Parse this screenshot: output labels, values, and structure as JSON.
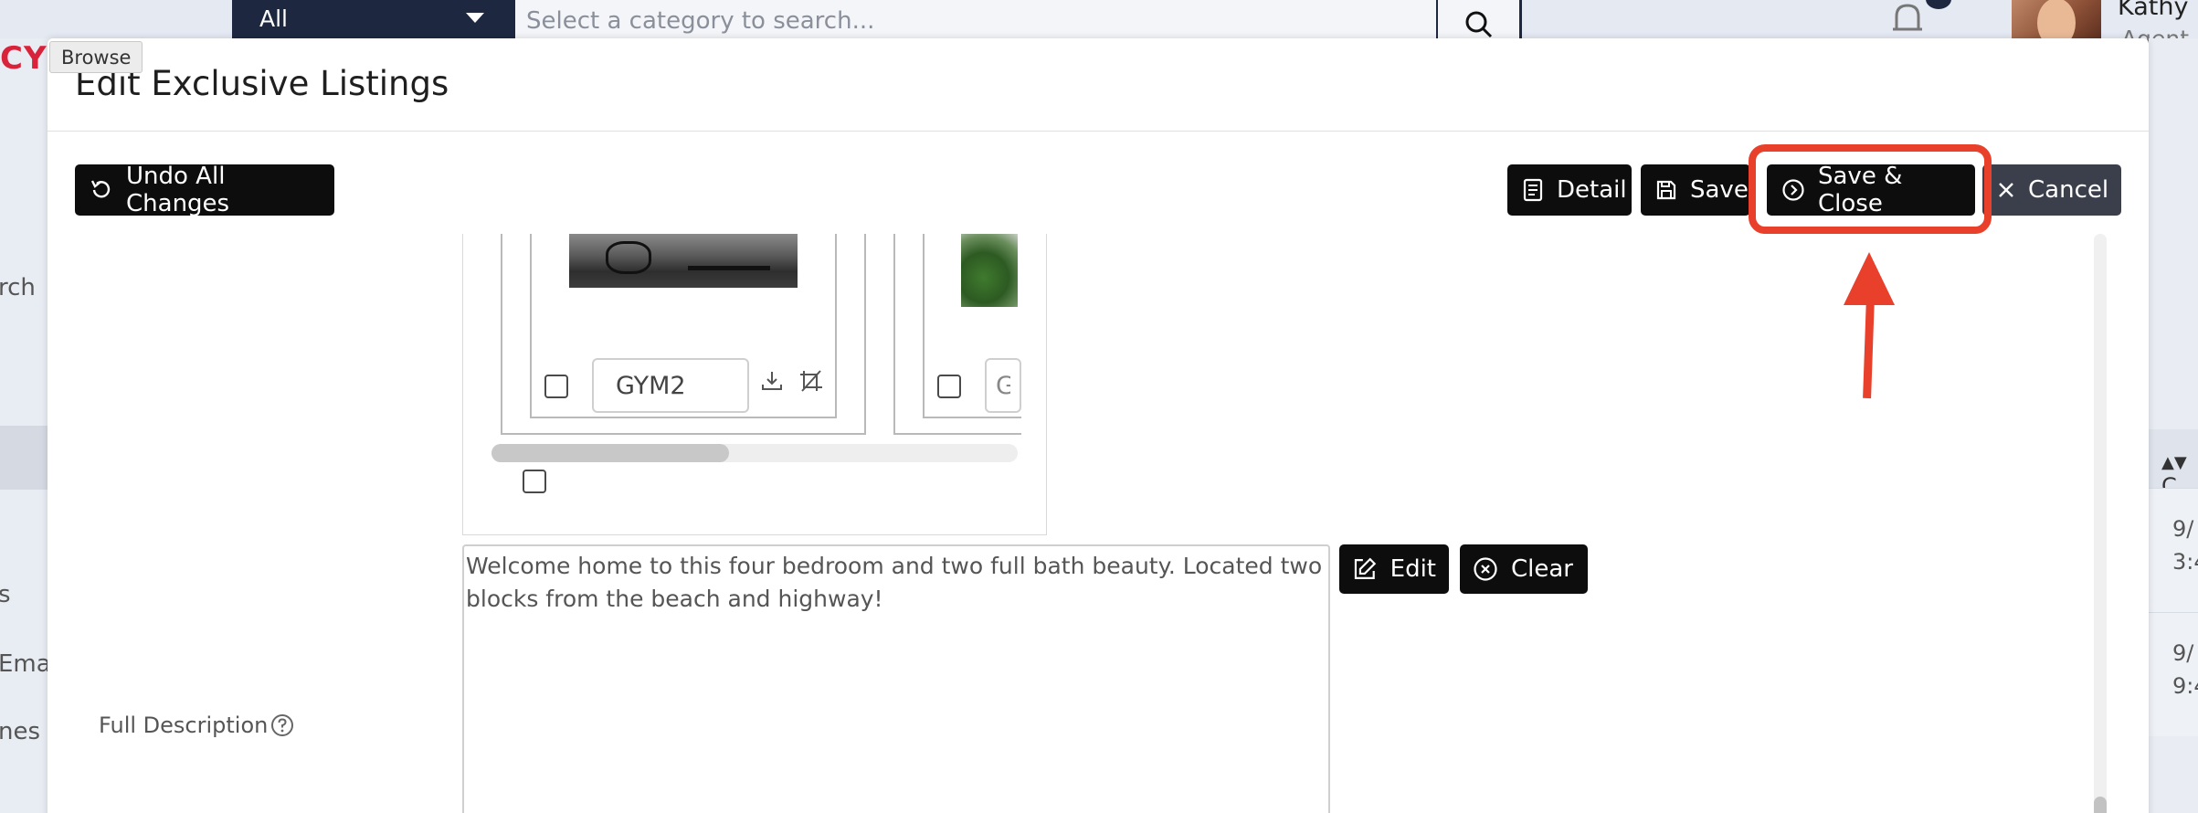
{
  "background": {
    "search_scope": "All",
    "search_placeholder": "Select a category to search...",
    "brand_fragment": "CY",
    "user_name": "Kathy",
    "user_role": "Agent",
    "left_nav_fragments": [
      "rch",
      "s",
      "Ema",
      "nes"
    ],
    "table_header_fragment": "C",
    "table_cells": [
      {
        "line1": "9/",
        "line2": "3:4"
      },
      {
        "line1": "9/",
        "line2": "9:4"
      }
    ]
  },
  "tooltip": "Browse",
  "modal": {
    "title": "Edit Exclusive Listings",
    "toolbar": {
      "undo_label": "Undo All Changes",
      "detail_label": "Detail",
      "save_label": "Save",
      "save_close_label": "Save & Close",
      "cancel_label": "Cancel"
    },
    "photos": [
      {
        "name": "GYM2"
      },
      {
        "name": "G"
      }
    ],
    "description": {
      "label": "Full Description",
      "text": "Welcome home to this four bedroom and two full bath beauty. Located two blocks from the beach and highway!",
      "edit_label": "Edit",
      "clear_label": "Clear"
    }
  },
  "colors": {
    "annotation": "#e8402b",
    "button": "#0d0d0d",
    "brand": "#d8233a",
    "nav": "#1d2740"
  }
}
